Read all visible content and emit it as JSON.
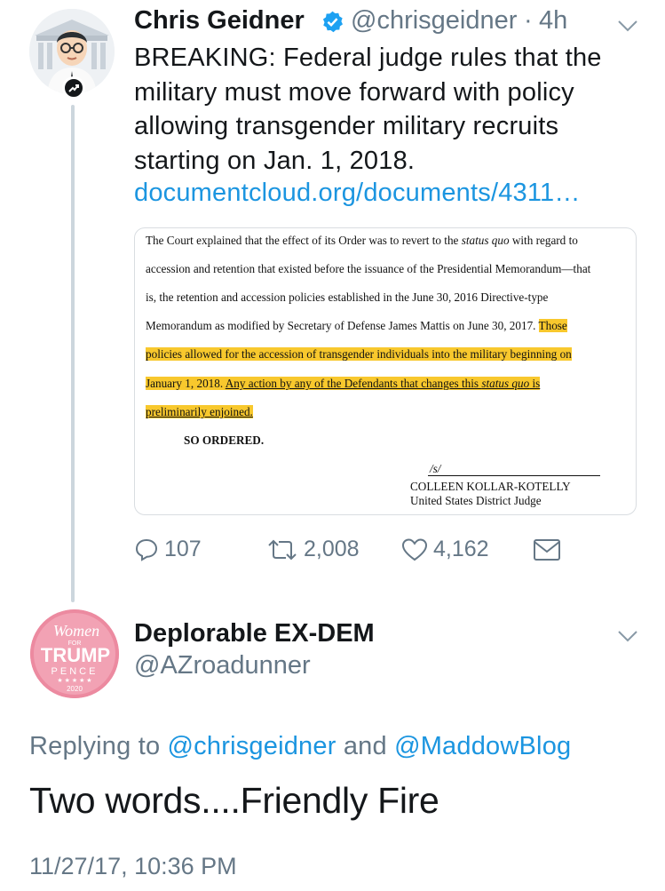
{
  "tweet": {
    "author_name": "Chris Geidner",
    "handle": "@chrisgeidner",
    "separator": "·",
    "time": "4h",
    "text": "BREAKING: Federal judge rules that the military must move forward with policy allowing transgender military recruits starting on Jan. 1, 2018.",
    "link": "documentcloud.org/documents/4311…",
    "document": {
      "line1a": "The Court explained that the effect of its Order was to revert to the ",
      "line1b": "status quo",
      "line1c": " with regard to",
      "line2": "accession and retention that existed before the issuance of the Presidential Memorandum—that",
      "line3": "is, the retention and accession policies established in the June 30, 2016 Directive-type",
      "line4a": "Memorandum as modified by Secretary of Defense James Mattis on June 30, 2017. ",
      "line4b": "Those",
      "line5": "policies allowed for the accession of transgender individuals into the military beginning on",
      "line6a": "January 1, 2018.  ",
      "line6b": "Any action by any of the Defendants that changes this ",
      "line6c": "status quo",
      "line6d": " is",
      "line7": "preliminarily enjoined.",
      "so_ordered": "SO ORDERED.",
      "signature": "/s/",
      "judge_name": "COLLEEN KOLLAR-KOTELLY",
      "judge_title": "United States District Judge"
    },
    "actions": {
      "replies": "107",
      "retweets": "2,008",
      "likes": "4,162"
    }
  },
  "reply": {
    "author_name": "Deplorable EX-DEM",
    "handle": "@AZroadunner",
    "avatar_text": {
      "women": "Women",
      "for": "FOR",
      "trump": "TRUMP",
      "pence": "PENCE",
      "year": "2020"
    },
    "replying_prefix": "Replying to ",
    "replying_user1": "@chrisgeidner",
    "replying_and": " and ",
    "replying_user2": "@MaddowBlog",
    "text": "Two words....Friendly Fire",
    "timestamp": "11/27/17, 10:36 PM"
  },
  "colors": {
    "link": "#1b95e0",
    "secondary_text": "#657786",
    "highlight": "#f8c82d",
    "thread_line": "#ccd6dd"
  }
}
